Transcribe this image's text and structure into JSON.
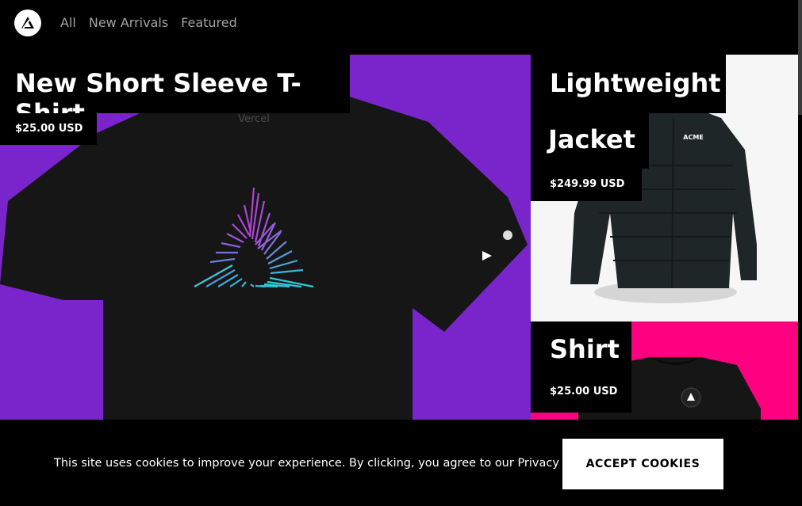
{
  "header": {
    "logo_icon": "triangle-logo-icon",
    "nav": [
      {
        "label": "All"
      },
      {
        "label": "New Arrivals"
      },
      {
        "label": "Featured"
      }
    ]
  },
  "products": {
    "main": {
      "title": "New Short Sleeve T-Shirt",
      "price": "$25.00 USD",
      "bg_color": "#7a25cc",
      "shirt_brand": "Vercel"
    },
    "jacket": {
      "title_line1": "Lightweight",
      "title_line2": "Jacket",
      "price": "$249.99 USD",
      "bg_color": "#f6f6f6",
      "brand": "ACME"
    },
    "shirt": {
      "title": "Shirt",
      "price": "$25.00 USD",
      "bg_color": "#ff0080"
    }
  },
  "cookie": {
    "message": "This site uses cookies to improve your experience. By clicking, you agree to our Privacy Policy.",
    "button_label": "ACCEPT COOKIES"
  }
}
